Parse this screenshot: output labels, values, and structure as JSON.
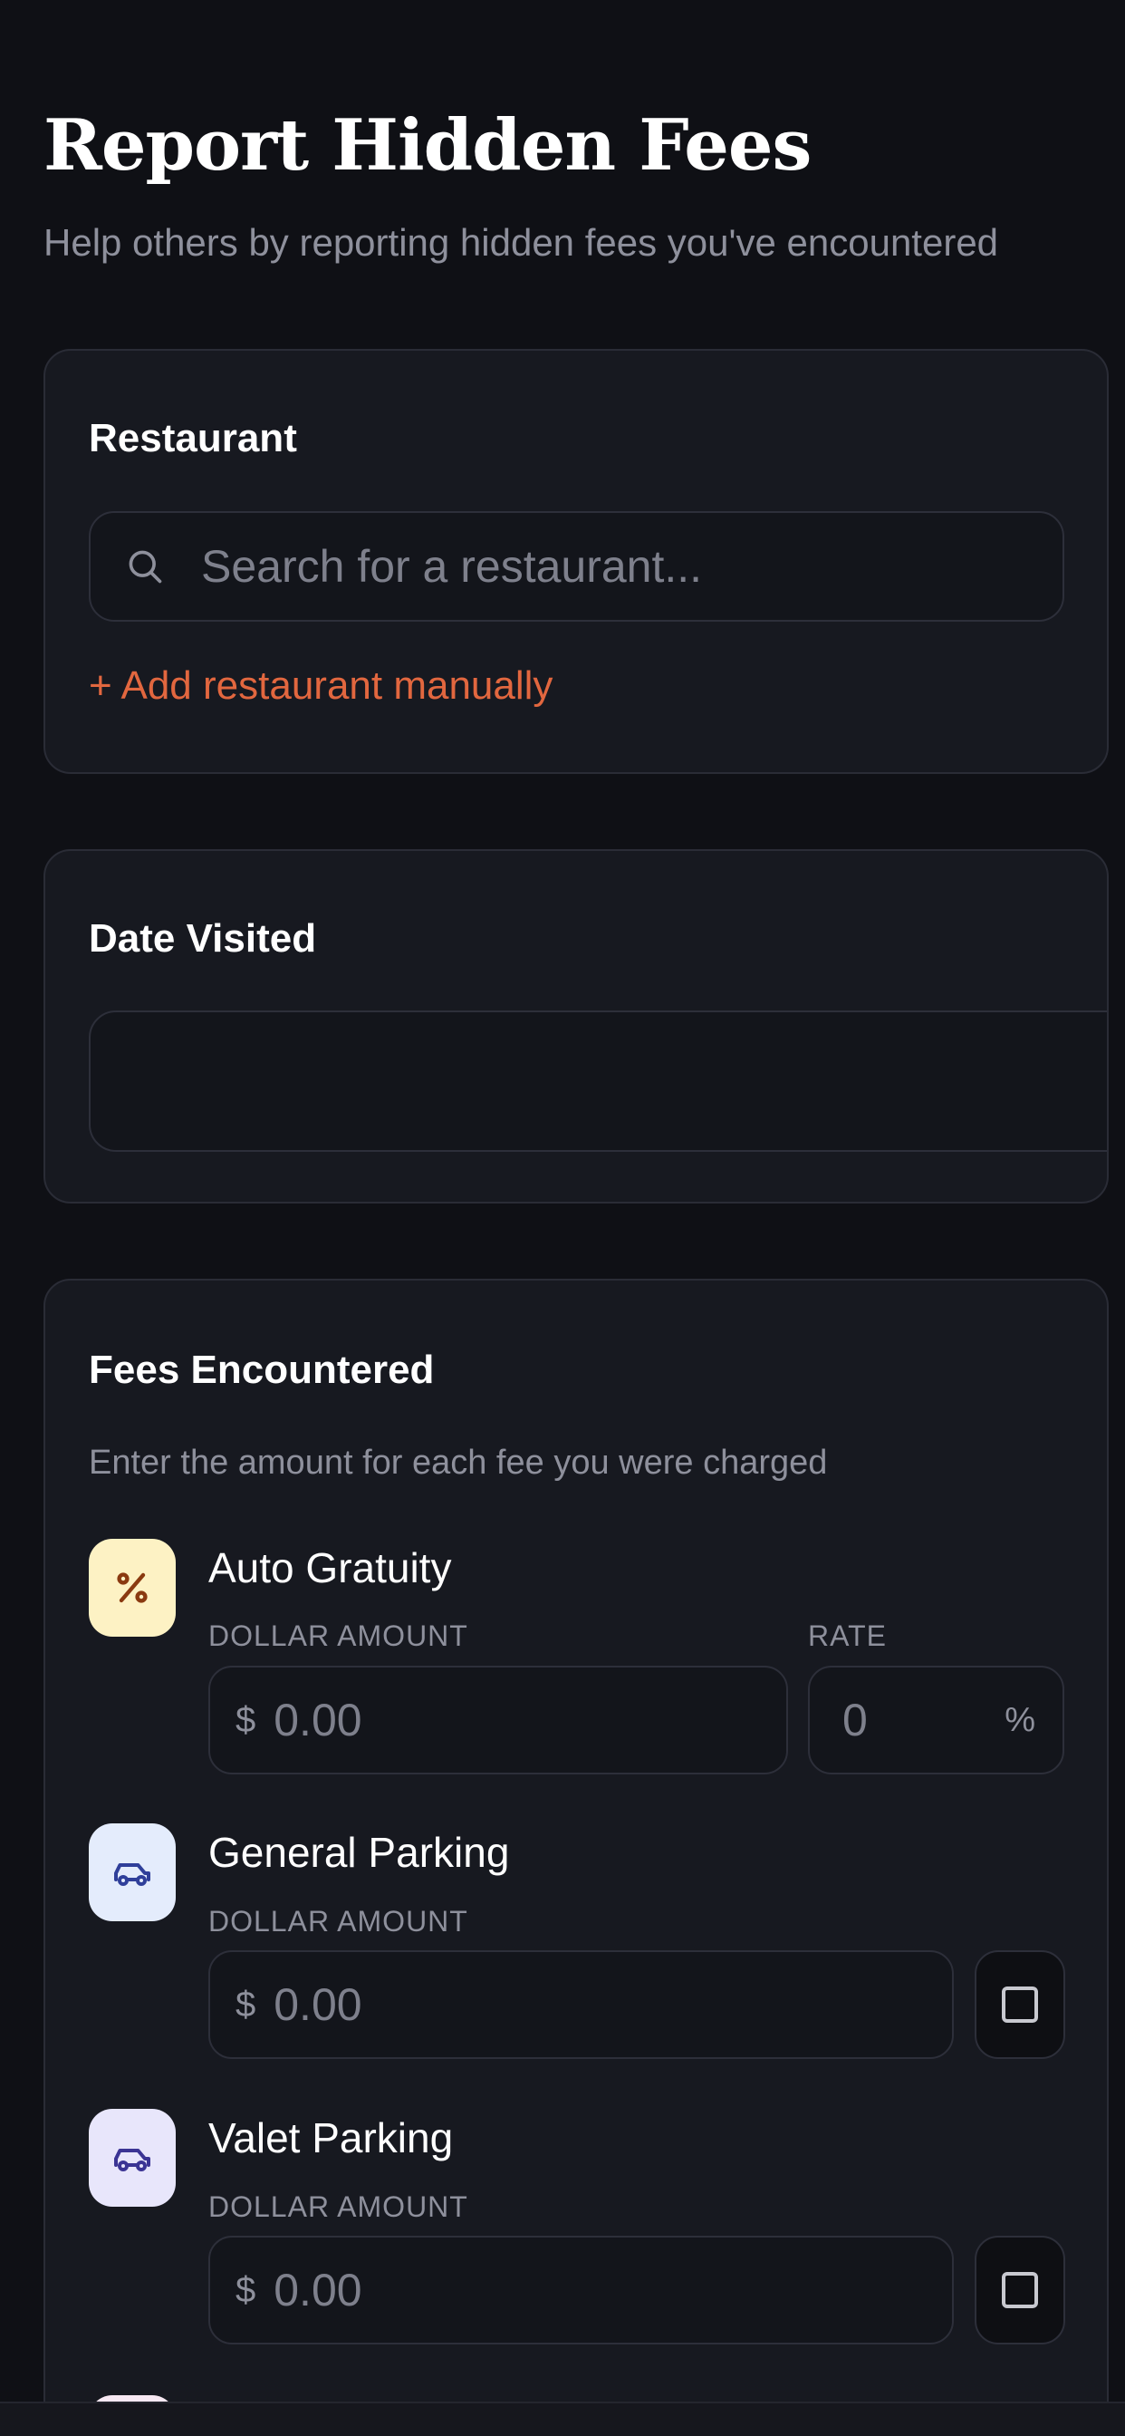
{
  "header": {
    "title": "Report Hidden Fees",
    "subtitle": "Help others by reporting hidden fees you've encountered"
  },
  "restaurant": {
    "label": "Restaurant",
    "search_placeholder": "Search for a restaurant...",
    "add_manual_label": "+ Add restaurant manually"
  },
  "date_visited": {
    "label": "Date Visited",
    "value": ""
  },
  "fees": {
    "label": "Fees Encountered",
    "description": "Enter the amount for each fee you were charged",
    "items": [
      {
        "name": "Auto Gratuity",
        "icon": "percent-icon",
        "icon_bg": "#fdf2c4",
        "icon_color": "#8a3a10",
        "amount_label": "DOLLAR AMOUNT",
        "currency": "$",
        "amount_placeholder": "0.00",
        "rate_label": "RATE",
        "rate_placeholder": "0",
        "rate_unit": "%"
      },
      {
        "name": "General Parking",
        "icon": "car-icon",
        "icon_bg": "#e4ecfc",
        "icon_color": "#2f3f9a",
        "amount_label": "DOLLAR AMOUNT",
        "currency": "$",
        "amount_placeholder": "0.00"
      },
      {
        "name": "Valet Parking",
        "icon": "car-icon",
        "icon_bg": "#e8e6fb",
        "icon_color": "#3b3494",
        "amount_label": "DOLLAR AMOUNT",
        "currency": "$",
        "amount_placeholder": "0.00"
      }
    ]
  },
  "colors": {
    "background": "#0f1015",
    "card": "#171920",
    "accent": "#e2673f"
  }
}
